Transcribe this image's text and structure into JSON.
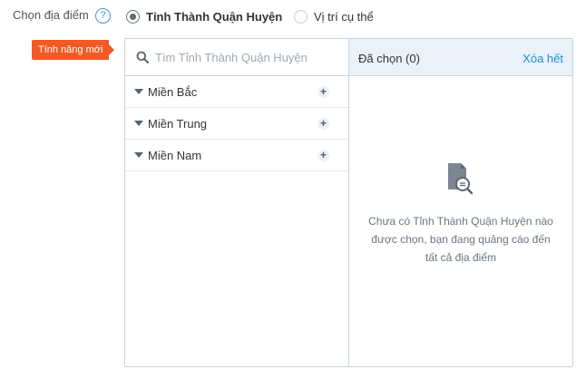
{
  "location_label": "Chọn địa điểm",
  "help_icon": "?",
  "options": [
    {
      "label": "Tỉnh Thành Quận Huyện",
      "selected": true
    },
    {
      "label": "Vị trí cụ thể",
      "selected": false
    }
  ],
  "badge": "Tính năng mới",
  "search": {
    "placeholder": "Tìm Tỉnh Thành Quận Huyện",
    "value": ""
  },
  "regions": [
    {
      "label": "Miền Bắc"
    },
    {
      "label": "Miền Trung"
    },
    {
      "label": "Miền Nam"
    }
  ],
  "selected_panel": {
    "title": "Đã chọn (0)",
    "clear_label": "Xóa hết",
    "empty_message": "Chưa có Tỉnh Thành Quận Huyện nào được chọn, bạn đang quảng cáo đến tất cả địa điểm"
  },
  "colors": {
    "accent": "#1e90d6",
    "badge": "#f15a24",
    "header_bg": "#eaf1f8",
    "border": "#c9d3de"
  },
  "icons": [
    "help-icon",
    "search-icon",
    "caret-down-icon",
    "plus-icon",
    "document-search-icon"
  ]
}
